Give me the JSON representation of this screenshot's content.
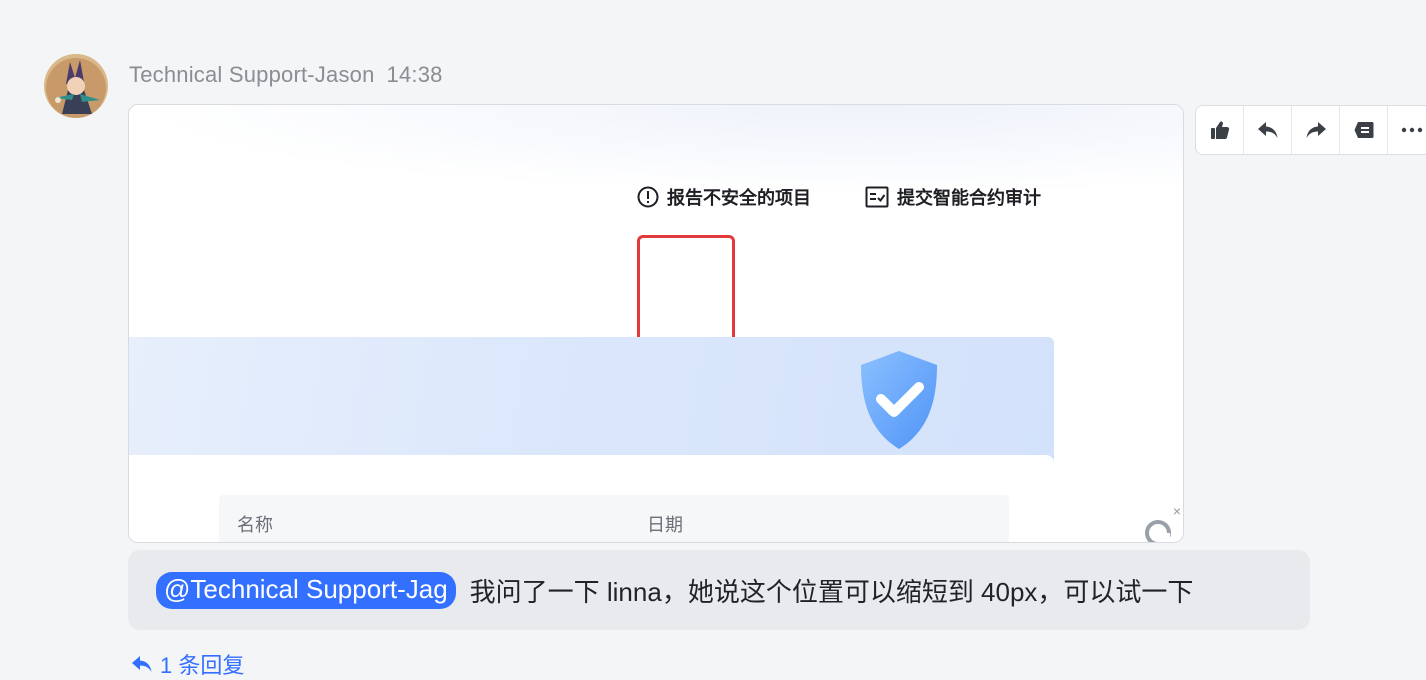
{
  "message": {
    "sender": "Technical Support-Jason",
    "time": "14:38",
    "avatar_icon": "avatar-anime-character",
    "screenshot": {
      "action_report": "报告不安全的项目",
      "action_report_icon": "exclamation-circle-icon",
      "action_audit": "提交智能合约审计",
      "action_audit_icon": "checklist-icon",
      "col_name": "名称",
      "col_date": "日期",
      "close_glyph": "×"
    },
    "mention": "@Technical Support-Jag",
    "text": "我问了一下 linna，她说这个位置可以缩短到 40px，可以试一下",
    "reply_count_label": "1 条回复"
  },
  "toolbar": {
    "buttons": [
      {
        "name": "thumbs-up-icon"
      },
      {
        "name": "reply-icon"
      },
      {
        "name": "forward-icon"
      },
      {
        "name": "quote-icon"
      },
      {
        "name": "more-icon"
      }
    ]
  },
  "colors": {
    "accent": "#3370ff",
    "bubble": "#e9eaed",
    "background": "#f4f5f7",
    "red_highlight": "#e23a3a"
  }
}
